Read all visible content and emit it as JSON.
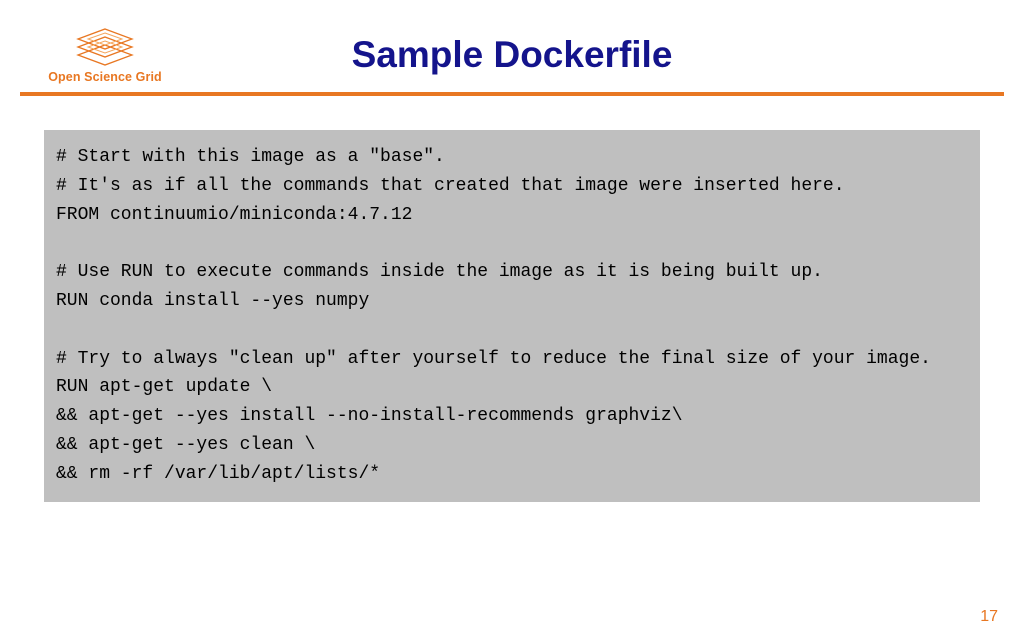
{
  "header": {
    "logo_text": "Open Science Grid",
    "title": "Sample Dockerfile"
  },
  "code_lines": [
    "# Start with this image as a \"base\".",
    "# It's as if all the commands that created that image were inserted here.",
    "FROM continuumio/miniconda:4.7.12",
    "",
    "# Use RUN to execute commands inside the image as it is being built up.",
    "RUN conda install --yes numpy",
    "",
    "# Try to always \"clean up\" after yourself to reduce the final size of your image.",
    "RUN apt-get update \\",
    "&& apt-get --yes install --no-install-recommends graphviz\\",
    "&& apt-get --yes clean \\",
    "&& rm -rf /var/lib/apt/lists/*"
  ],
  "page_number": "17",
  "colors": {
    "brand_orange": "#e87722",
    "title_navy": "#14148c",
    "code_bg": "#bfbfbf"
  }
}
